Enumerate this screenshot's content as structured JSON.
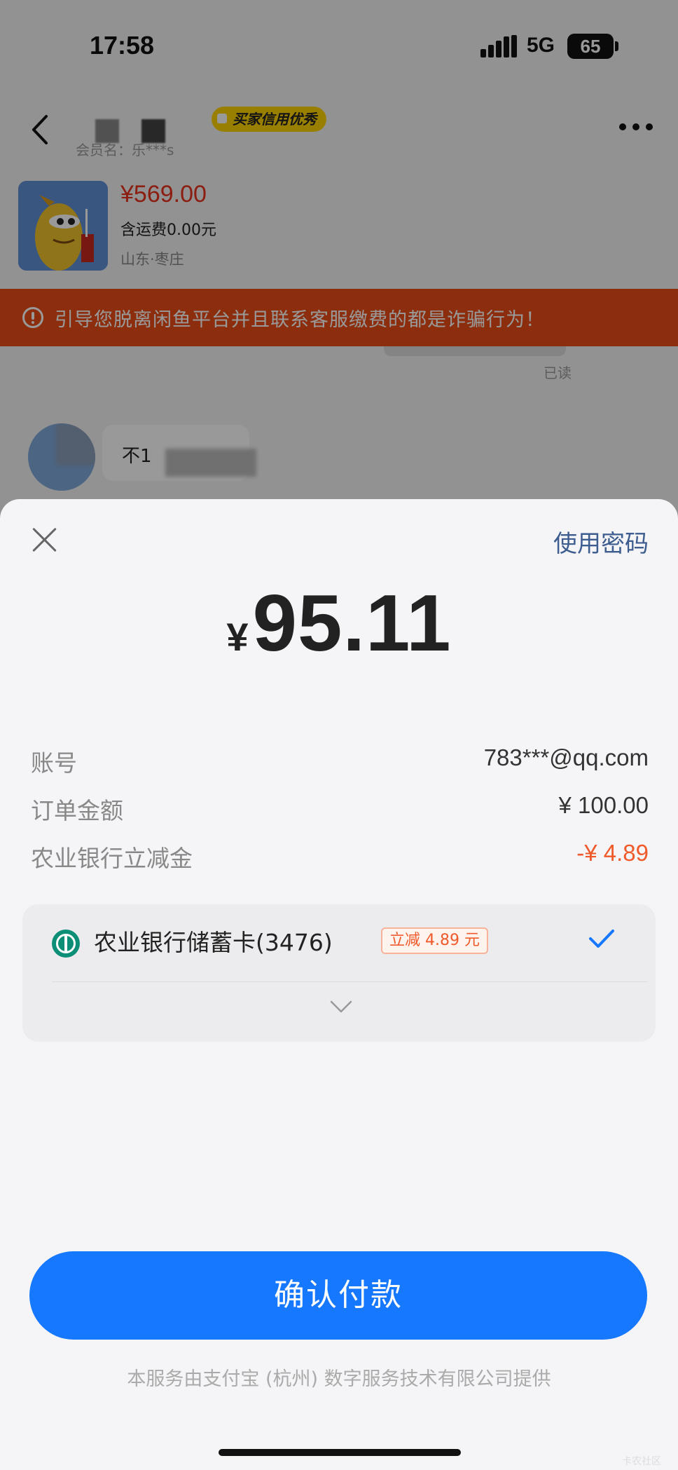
{
  "status_bar": {
    "time": "17:58",
    "network": "5G",
    "battery": "65"
  },
  "nav": {
    "credit_badge": "买家信用优秀",
    "member_name": "会员名：乐***s"
  },
  "product": {
    "price": "¥569.00",
    "shipping": "含运费0.00元",
    "location": "山东·枣庄"
  },
  "warning": {
    "text": "引导您脱离闲鱼平台并且联系客服缴费的都是诈骗行为！"
  },
  "chat": {
    "read_label": "已读",
    "message_prefix": "不1"
  },
  "sheet": {
    "use_password": "使用密码",
    "amount_currency": "¥",
    "amount_value": "95.11",
    "details": [
      {
        "label": "账号",
        "value": "783***@qq.com"
      },
      {
        "label": "订单金额",
        "value": "¥ 100.00"
      },
      {
        "label": "农业银行立减金",
        "value": "-¥ 4.89"
      }
    ],
    "card": {
      "name": "农业银行储蓄卡(3476)",
      "discount_tag": "立减 4.89 元",
      "bank_brand_color": "#0c8e77"
    },
    "confirm_label": "确认付款",
    "footer": "本服务由支付宝 (杭州) 数字服务技术有限公司提供",
    "watermark": "卡农社区"
  },
  "colors": {
    "primary_button": "#1677ff",
    "warning_banner": "#ea4e16",
    "discount_red": "#f05a2a",
    "link_blue": "#3d5c8f"
  },
  "icons": [
    "back-arrow-icon",
    "more-icon",
    "warning-icon",
    "close-icon",
    "bank-logo-icon",
    "check-icon",
    "chevron-down-icon"
  ]
}
